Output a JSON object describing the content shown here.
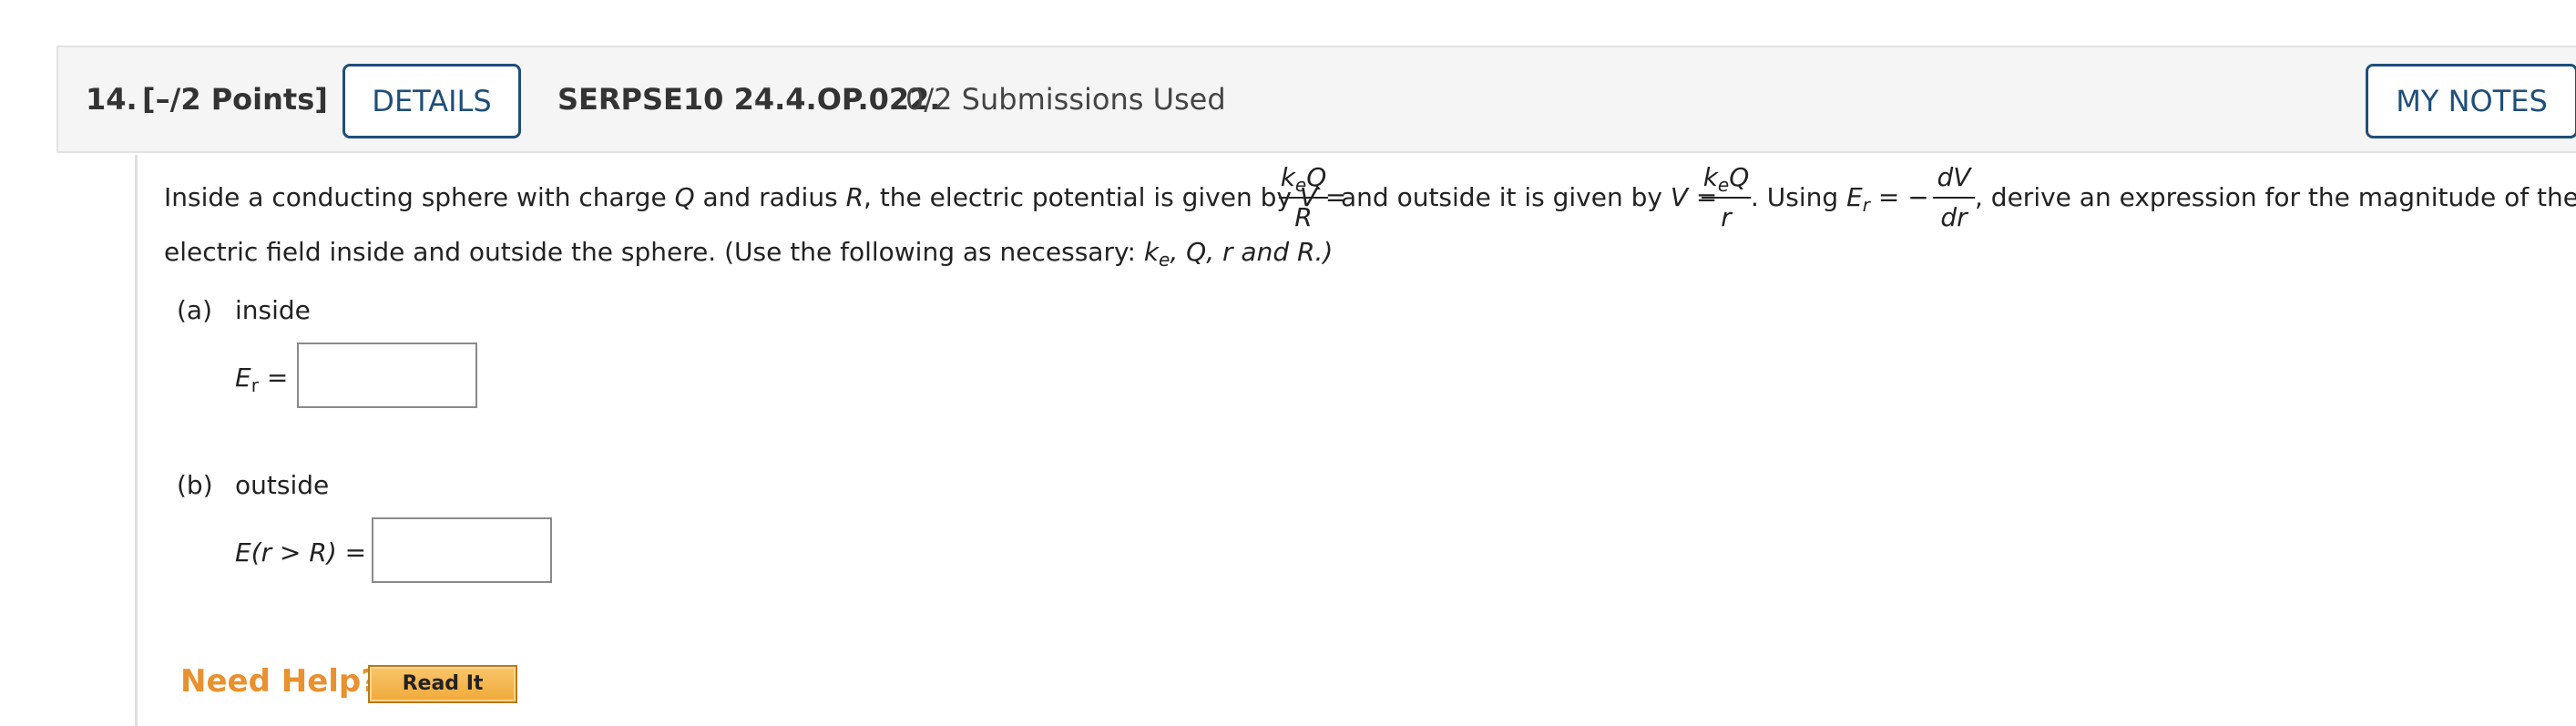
{
  "header": {
    "number": "14.",
    "points": "[–/2 Points]",
    "details_label": "DETAILS",
    "code": "SERPSE10 24.4.OP.022.",
    "submissions": "0/2 Submissions Used",
    "mynotes_label": "MY NOTES"
  },
  "question": {
    "line1_a": "Inside a conducting sphere with charge ",
    "Q": "Q",
    "and_radius": " and radius ",
    "R": "R",
    "potential_text": ", the electric potential is given by ",
    "V": "V",
    "equals": " =",
    "frac1_num": "k",
    "frac1_num_sub": "e",
    "frac1_num_Q": "Q",
    "frac1_den": "R",
    "outside_text": "and outside it is given by ",
    "frac2_num": "k",
    "frac2_num_sub": "e",
    "frac2_num_Q": "Q",
    "frac2_den": "r",
    "using_text": ". Using ",
    "E": "E",
    "r_sub": "r",
    "minus": " = −",
    "frac3_num": "dV",
    "frac3_den": "dr",
    "derive_text": ", derive an expression for the magnitude of the",
    "line2_a": "electric field inside and outside the sphere. (Use the following as necessary: ",
    "ke_k": "k",
    "ke_e": "e",
    "vars_rest": ", Q, r and R.)"
  },
  "part_a": {
    "label": "(a)",
    "title": "inside",
    "lhs_E": "E",
    "lhs_sub": "r",
    "lhs_eq": " =",
    "value": ""
  },
  "part_b": {
    "label": "(b)",
    "title": "outside",
    "lhs": "E(r > R) =",
    "value": ""
  },
  "help": {
    "label": "Need Help?",
    "read_it": "Read It"
  }
}
